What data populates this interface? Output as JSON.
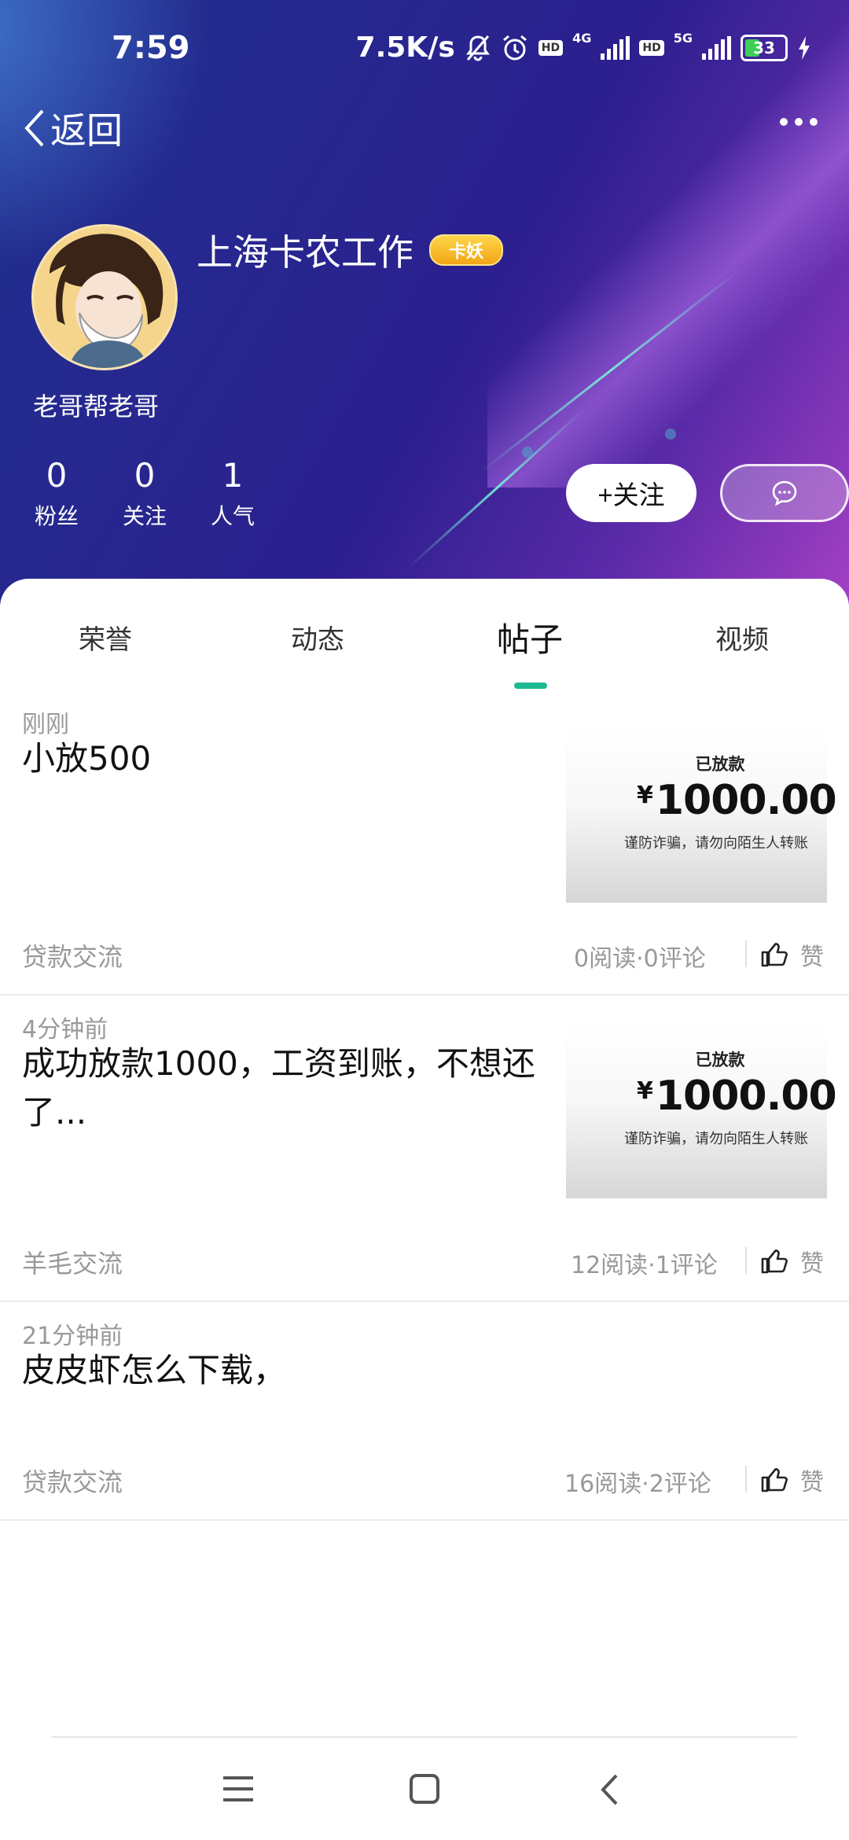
{
  "status_bar": {
    "time": "7:59",
    "net_speed": "7.5K/s",
    "hd1": "HD",
    "net1": "4G",
    "hd2": "HD",
    "net2": "5G",
    "battery": "33"
  },
  "header": {
    "back_label": "返回",
    "username": "上海卡农工作",
    "badge": "卡妖",
    "bio": "老哥帮老哥",
    "stats": [
      {
        "value": "0",
        "label": "粉丝"
      },
      {
        "value": "0",
        "label": "关注"
      },
      {
        "value": "1",
        "label": "人气"
      }
    ],
    "follow_label": "+关注"
  },
  "tabs": [
    {
      "label": "荣誉"
    },
    {
      "label": "动态"
    },
    {
      "label": "帖子",
      "active": true
    },
    {
      "label": "视频"
    }
  ],
  "posts": [
    {
      "time": "刚刚",
      "title": "小放500",
      "category": "贷款交流",
      "stats": "0阅读·0评论",
      "like": "赞",
      "image": {
        "status": "已放款",
        "currency": "¥",
        "amount": "1000.00",
        "note": "谨防诈骗，请勿向陌生人转账"
      }
    },
    {
      "time": "4分钟前",
      "title": "成功放款1000，工资到账，不想还了...",
      "category": "羊毛交流",
      "stats": "12阅读·1评论",
      "like": "赞",
      "image": {
        "status": "已放款",
        "currency": "¥",
        "amount": "1000.00",
        "note": "谨防诈骗，请勿向陌生人转账"
      }
    },
    {
      "time": "21分钟前",
      "title": "皮皮虾怎么下载，",
      "category": "贷款交流",
      "stats": "16阅读·2评论",
      "like": "赞"
    }
  ],
  "colors": {
    "accent": "#1bb992",
    "header_start": "#1f2f8c",
    "header_end": "#a43fc4"
  },
  "icons": [
    "back-chevron-icon",
    "more-dots-icon",
    "chat-bubble-icon",
    "thumbs-up-icon",
    "menu-icon",
    "home-square-icon",
    "nav-back-icon"
  ]
}
